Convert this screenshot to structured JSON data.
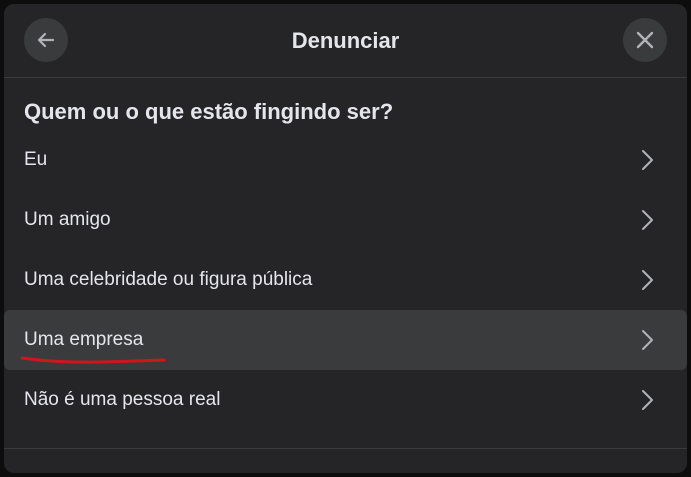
{
  "header": {
    "title": "Denunciar",
    "back_icon": "arrow-left-icon",
    "close_icon": "close-icon"
  },
  "question": "Quem ou o que estão fingindo ser?",
  "options": [
    {
      "label": "Eu",
      "icon": "chevron-right-icon"
    },
    {
      "label": "Um amigo",
      "icon": "chevron-right-icon"
    },
    {
      "label": "Uma celebridade ou figura pública",
      "icon": "chevron-right-icon"
    },
    {
      "label": "Uma empresa",
      "icon": "chevron-right-icon",
      "highlighted": true,
      "annotated_underline_color": "#d0161d"
    },
    {
      "label": "Não é uma pessoa real",
      "icon": "chevron-right-icon"
    }
  ],
  "colors": {
    "dialog_bg": "#252527",
    "button_bg": "#3a3b3c",
    "text": "#e4e6eb",
    "annotation": "#d0161d"
  }
}
